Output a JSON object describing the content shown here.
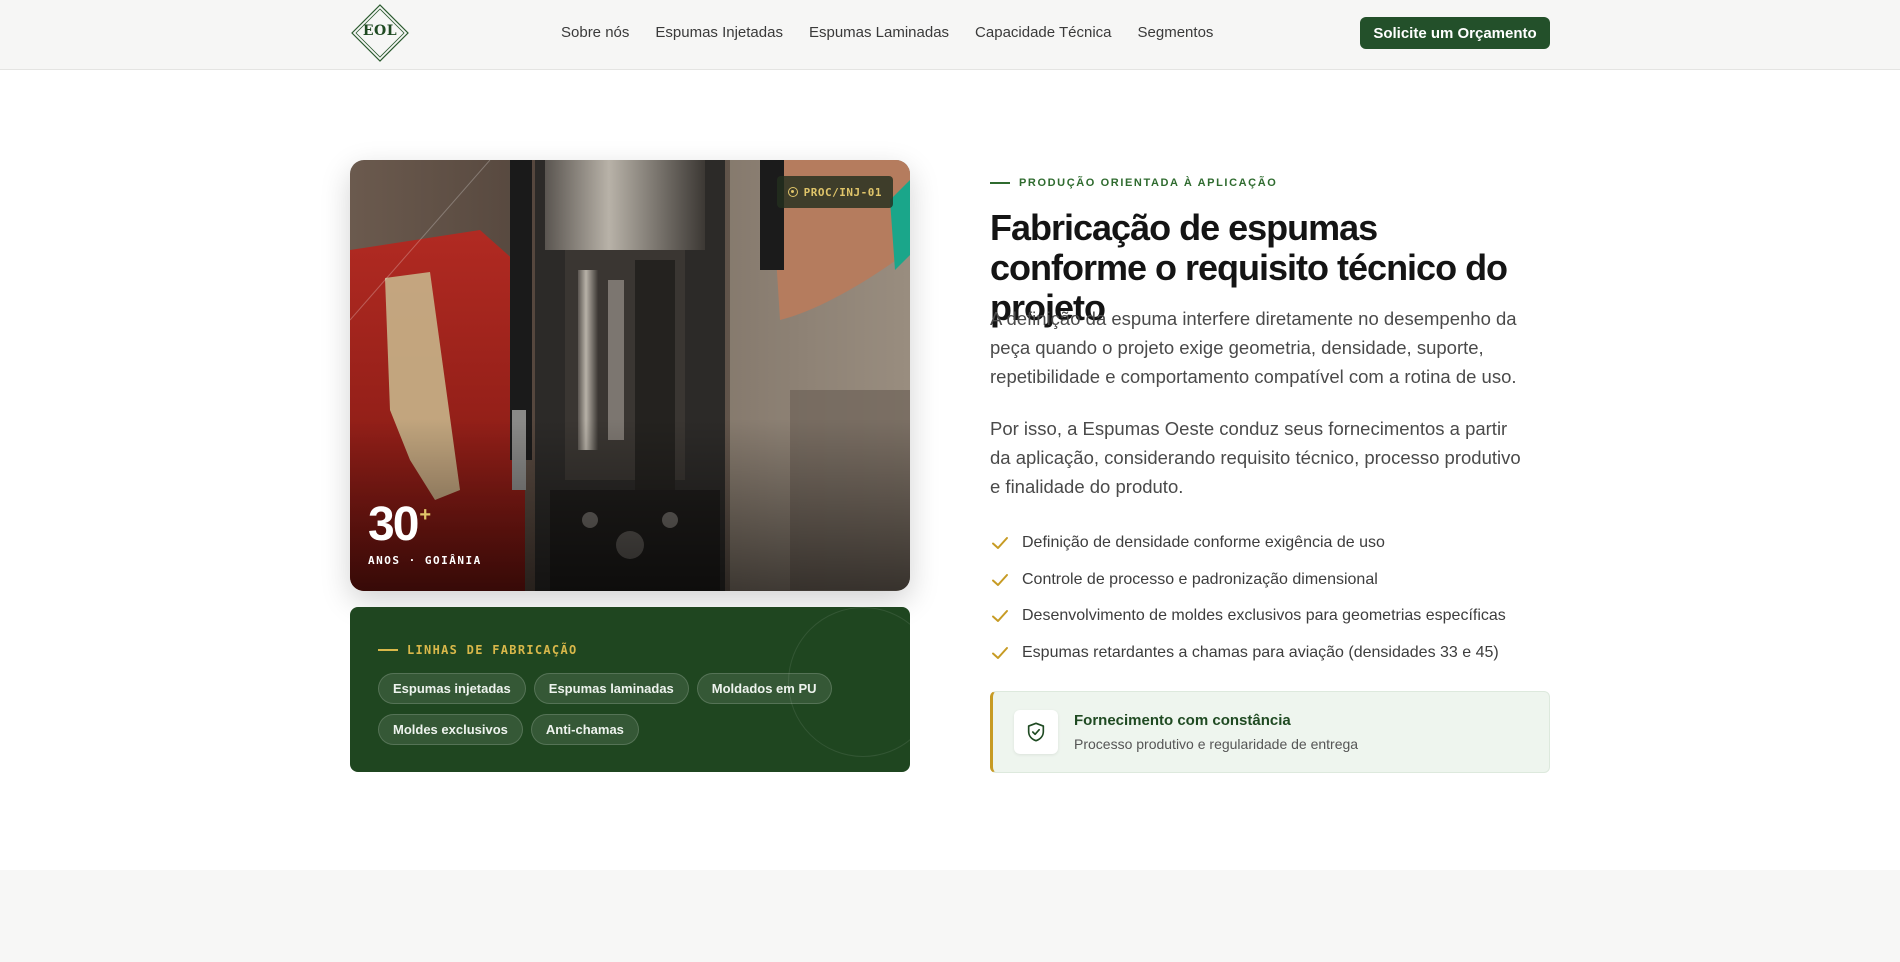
{
  "header": {
    "logo_text": "EOL",
    "nav": [
      "Sobre nós",
      "Espumas Injetadas",
      "Espumas Laminadas",
      "Capacidade Técnica",
      "Segmentos"
    ],
    "cta_label": "Solicite um Orçamento"
  },
  "photo_card": {
    "badge": "PROC/INJ-01",
    "years_number": "30",
    "years_plus": "+",
    "years_label": "ANOS · GOIÂNIA"
  },
  "lines_card": {
    "title": "LINHAS DE FABRICAÇÃO",
    "chips": [
      "Espumas injetadas",
      "Espumas laminadas",
      "Moldados em PU",
      "Moldes exclusivos",
      "Anti-chamas"
    ]
  },
  "content": {
    "eyebrow": "PRODUÇÃO ORIENTADA À APLICAÇÃO",
    "title": "Fabricação de espumas conforme o requisito técnico do projeto",
    "paragraph1": "A definição da espuma interfere diretamente no desempenho da peça quando o projeto exige geometria, densidade, suporte, repetibilidade e comportamento compatível com a rotina de uso.",
    "paragraph2": "Por isso, a Espumas Oeste conduz seus fornecimentos a partir da aplicação, considerando requisito técnico, processo produtivo e finalidade do produto.",
    "checklist": [
      "Definição de densidade conforme exigência de uso",
      "Controle de processo e padronização dimensional",
      "Desenvolvimento de moldes exclusivos para geometrias específicas",
      "Espumas retardantes a chamas para aviação (densidades 33 e 45)"
    ],
    "supply_title": "Fornecimento com constância",
    "supply_subtitle": "Processo produtivo e regularidade de entrega"
  },
  "colors": {
    "brand_green": "#23502a",
    "dark_green_card": "#1f4620",
    "accent_gold": "#d9b84a",
    "check_gold": "#c79b24"
  },
  "icons": [
    "logo-diamond-icon",
    "target-icon",
    "check-icon",
    "shield-check-icon"
  ]
}
